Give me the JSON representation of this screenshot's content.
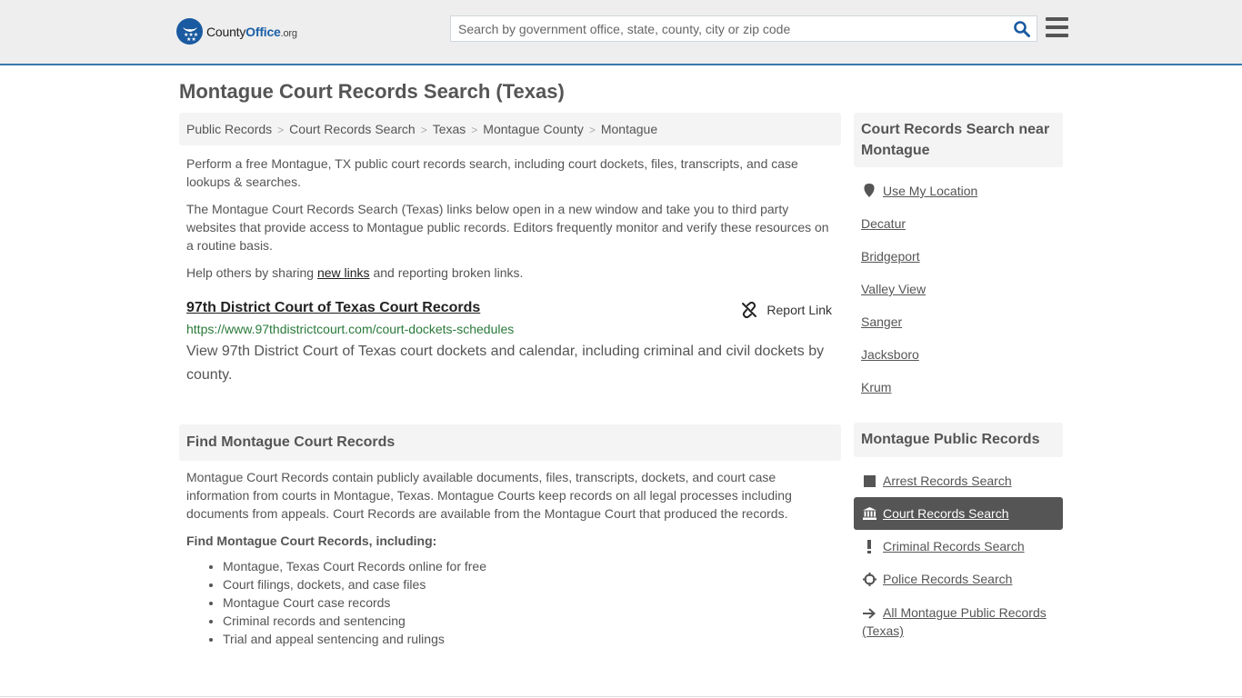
{
  "header": {
    "logo": {
      "name_part1": "County",
      "name_part2": "Office",
      "tld": ".org"
    },
    "search": {
      "placeholder": "Search by government office, state, county, city or zip code",
      "value": ""
    },
    "search_icon": "search-icon",
    "menu_icon": "hamburger-menu-icon"
  },
  "page": {
    "title": "Montague Court Records Search (Texas)"
  },
  "breadcrumb": [
    {
      "label": "Public Records"
    },
    {
      "label": "Court Records Search"
    },
    {
      "label": "Texas"
    },
    {
      "label": "Montague County"
    },
    {
      "label": "Montague"
    }
  ],
  "intro": {
    "p1": "Perform a free Montague, TX public court records search, including court dockets, files, transcripts, and case lookups & searches.",
    "p2": "The Montague Court Records Search (Texas) links below open in a new window and take you to third party websites that provide access to Montague public records. Editors frequently monitor and verify these resources on a routine basis.",
    "p3_before": "Help others by sharing ",
    "p3_link": "new links",
    "p3_after": " and reporting broken links."
  },
  "results": [
    {
      "title": "97th District Court of Texas Court Records",
      "url": "https://www.97thdistrictcourt.com/court-dockets-schedules",
      "description": "View 97th District Court of Texas court dockets and calendar, including criminal and civil dockets by county.",
      "report_label": "Report Link"
    }
  ],
  "find_section": {
    "heading": "Find Montague Court Records",
    "body": "Montague Court Records contain publicly available documents, files, transcripts, dockets, and court case information from courts in Montague, Texas. Montague Courts keep records on all legal processes including documents from appeals. Court Records are available from the Montague Court that produced the records.",
    "subheading": "Find Montague Court Records, including:",
    "items": [
      "Montague, Texas Court Records online for free",
      "Court filings, dockets, and case files",
      "Montague Court case records",
      "Criminal records and sentencing",
      "Trial and appeal sentencing and rulings"
    ]
  },
  "sidebar": {
    "nearby": {
      "heading": "Court Records Search near Montague",
      "use_location": "Use My Location",
      "cities": [
        "Decatur",
        "Bridgeport",
        "Valley View",
        "Sanger",
        "Jacksboro",
        "Krum"
      ]
    },
    "public_records": {
      "heading": "Montague Public Records",
      "items": [
        {
          "label": "Arrest Records Search",
          "icon": "square-icon",
          "active": false
        },
        {
          "label": "Court Records Search",
          "icon": "courthouse-icon",
          "active": true
        },
        {
          "label": "Criminal Records Search",
          "icon": "exclamation-icon",
          "active": false
        },
        {
          "label": "Police Records Search",
          "icon": "crosshair-icon",
          "active": false
        },
        {
          "label": "All Montague Public Records (Texas)",
          "icon": "arrow-right-icon",
          "active": false
        }
      ]
    }
  },
  "colors": {
    "brand_blue": "#1a5aa0",
    "header_border": "#3a7aad",
    "url_green": "#2a7a3a",
    "active_bg": "#555555"
  }
}
